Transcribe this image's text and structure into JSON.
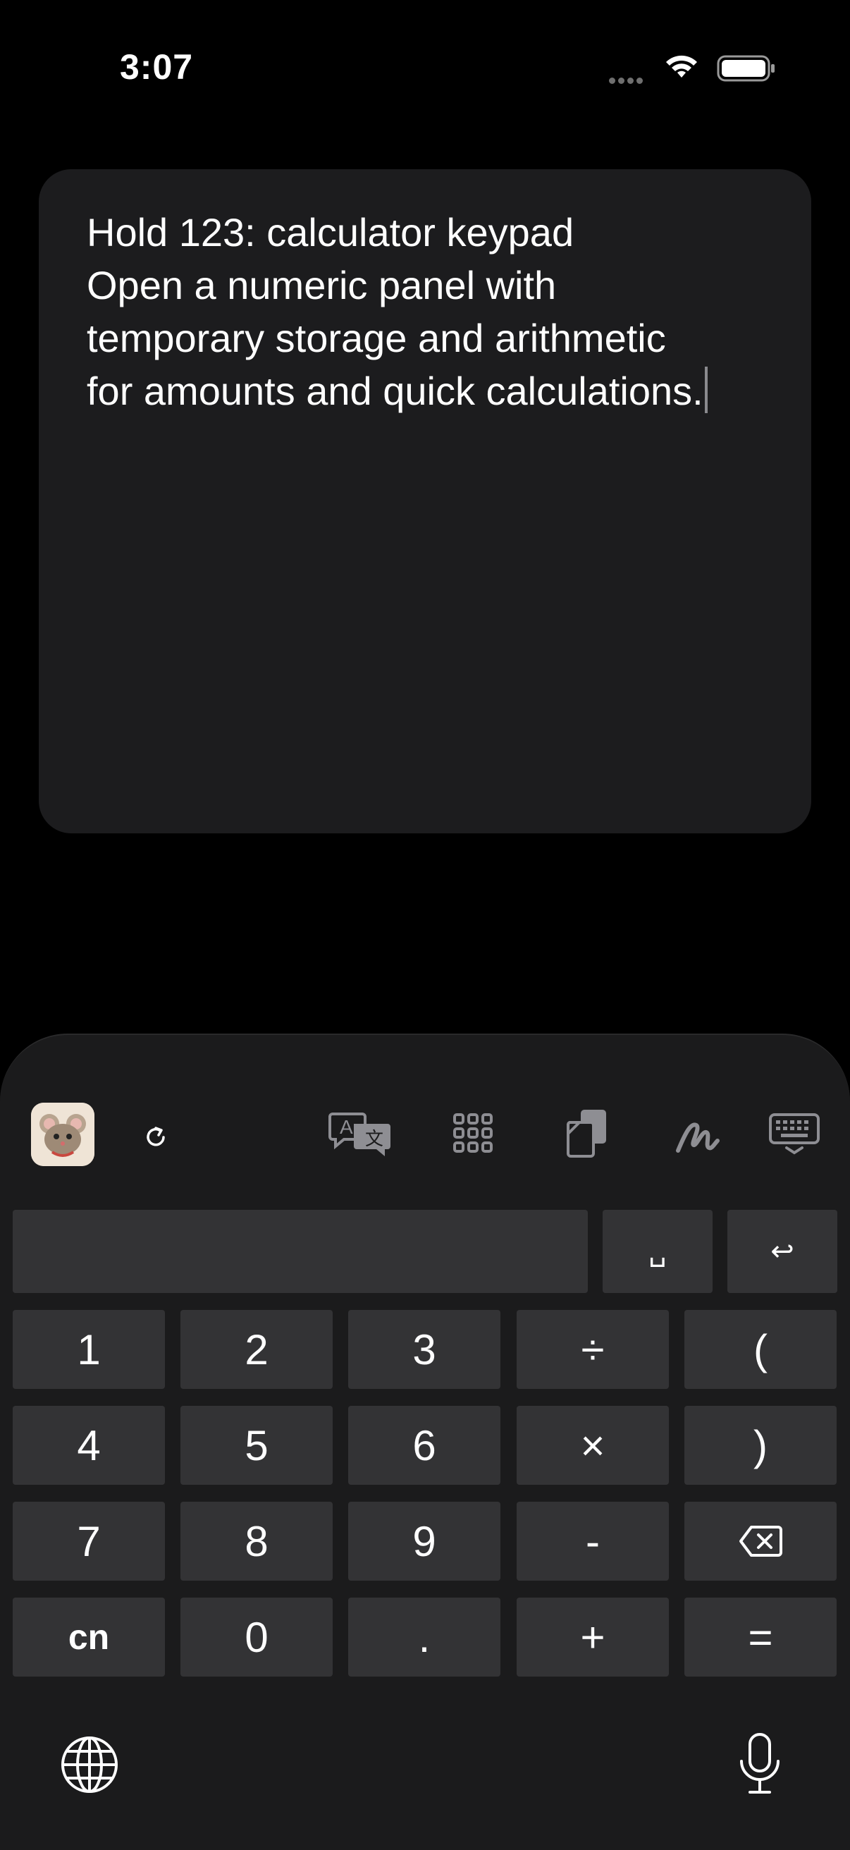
{
  "status_bar": {
    "time": "3:07"
  },
  "editor": {
    "lines": [
      "Hold 123: calculator keypad",
      "Open a numeric panel with",
      "temporary storage and arithmetic",
      "for amounts and quick calculations."
    ]
  },
  "keyboard": {
    "toolbar_icons": [
      "app-avatar-icon",
      "refresh-icon",
      "translate-icon",
      "grid-icon",
      "clipboard-icon",
      "handwriting-icon",
      "keyboard-hide-icon"
    ],
    "composer": {
      "space_label": "␣",
      "return_label": "↩"
    },
    "keys": {
      "row1": [
        "1",
        "2",
        "3",
        "÷",
        "("
      ],
      "row2": [
        "4",
        "5",
        "6",
        "×",
        ")"
      ],
      "row3": [
        "7",
        "8",
        "9",
        "-",
        "backspace"
      ],
      "row4": [
        "cn",
        "0",
        ".",
        "+",
        "="
      ]
    },
    "bottom_icons": [
      "globe-icon",
      "microphone-icon"
    ]
  },
  "colors": {
    "background": "#000000",
    "card": "#1c1c1e",
    "keyboard_bg": "#1b1b1c",
    "key_bg": "#333335",
    "text": "#ffffff"
  }
}
